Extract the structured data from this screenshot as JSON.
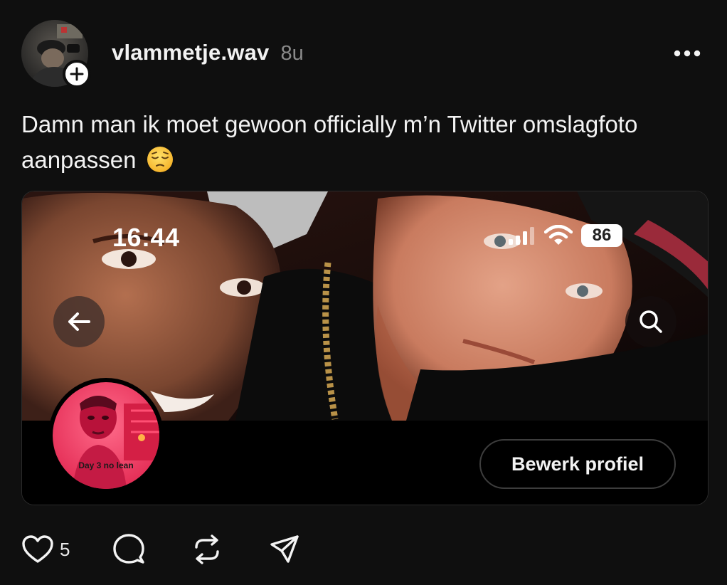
{
  "post": {
    "username": "vlammetje.wav",
    "timestamp": "8u",
    "text": "Damn man ik moet gewoon officially m’n Twitter omslagfoto aanpassen",
    "emoji": "pensive-face"
  },
  "embedded_screenshot": {
    "status_time": "16:44",
    "battery": "86",
    "profile_picture_caption": "Day 3 no lean",
    "edit_profile_label": "Bewerk profiel",
    "icons": [
      "back-arrow-icon",
      "search-icon",
      "signal-icon",
      "wifi-icon",
      "battery-icon"
    ]
  },
  "actions": {
    "like_count": "5",
    "icons": [
      "heart-icon",
      "comment-icon",
      "repost-icon",
      "share-icon"
    ]
  },
  "colors": {
    "background": "#0f0f0f",
    "text": "#f3f3f3",
    "muted": "#8a8a8a",
    "profile_tint": "#ff3f6e"
  }
}
